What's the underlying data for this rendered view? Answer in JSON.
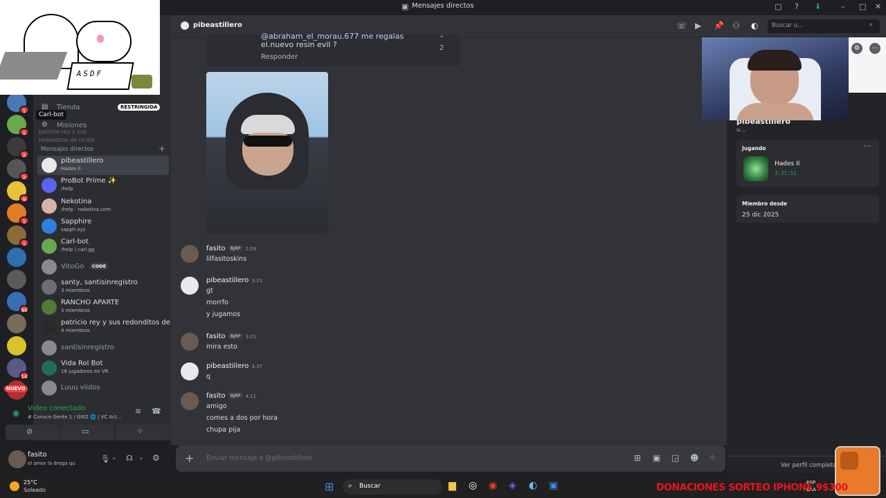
{
  "window": {
    "title": "Mensajes directos"
  },
  "overlay_keyboard_text": "ASDF",
  "sidebar": {
    "tienda": "Tienda",
    "restringida": "RESTRINGIDA",
    "tooltip": "Carl-bot",
    "tooltip_sub": "patricio rey y sus redonditos de ricota",
    "misiones": "Misiones",
    "dm_header": "Mensajes directos",
    "dms": [
      {
        "name": "pibeastillero",
        "sub": "Hades II",
        "color": "#e9e9e9"
      },
      {
        "name": "ProBot Prime ✨",
        "sub": "/help",
        "color": "#5865f2"
      },
      {
        "name": "Nekotina",
        "sub": "!help · nekotina.com",
        "color": "#d6b3a8"
      },
      {
        "name": "Sapphire",
        "sub": "sapph.xyz",
        "color": "#2f7fe0"
      },
      {
        "name": "Carl-bot",
        "sub": "/help | carl.gg",
        "color": "#6aa84f"
      },
      {
        "name": "VitoGo",
        "sub": "",
        "badge": "CODE",
        "color": "#8a8a8a"
      },
      {
        "name": "santy, santisinregistro",
        "sub": "3 miembros",
        "color": "#6d6f78"
      },
      {
        "name": "RANCHO APARTE",
        "sub": "3 miembros",
        "color": "#4f7a3a"
      },
      {
        "name": "patricio rey y sus redonditos de ...",
        "sub": "4 miembros",
        "color": "#2a2a2a"
      },
      {
        "name": "santisinregistro",
        "sub": "",
        "color": "#8a8a8a"
      },
      {
        "name": "Vida Rol Bot",
        "sub": "16 jugadores en VR.",
        "color": "#1f6d5a"
      },
      {
        "name": "Luuu viidos",
        "sub": "",
        "color": "#8a8a8a"
      }
    ],
    "servers": [
      {
        "badge": "1",
        "color": "#4a7ab5"
      },
      {
        "badge": "1",
        "color": "#6aa84f"
      },
      {
        "badge": "2",
        "color": "#3b3b3b"
      },
      {
        "badge": "2",
        "color": "#555555"
      },
      {
        "badge": "9",
        "color": "#e8c23a"
      },
      {
        "badge": "1",
        "color": "#e07b28"
      },
      {
        "badge": "1",
        "color": "#8b6b3a"
      },
      {
        "badge": "",
        "color": "#2f6fae"
      },
      {
        "badge": "",
        "color": "#5a5a5a"
      },
      {
        "badge": "90",
        "color": "#3a6fb5"
      },
      {
        "badge": "",
        "color": "#7a6a5a"
      },
      {
        "badge": "",
        "color": "#d9c22a"
      },
      {
        "badge": "14",
        "color": "#5a5a8a"
      },
      {
        "badge": "",
        "color": "#b03030"
      }
    ],
    "nuevo": "NUEVO",
    "voice": {
      "status": "Video conectado",
      "channel": "# Conoce Gente 1 / GW2 🌐 | VC Act..."
    },
    "user": {
      "name": "fasito",
      "status": "el amor la droga qu"
    }
  },
  "header": {
    "name": "pibeastillero",
    "search_placeholder": "Buscar u..."
  },
  "chat": {
    "reply_line1": "@abraham_el_morau.677 me regalas",
    "reply_line2": "el.nuevo resin  evil ?",
    "reply_count": "2",
    "reply_button": "Responder",
    "messages": [
      {
        "author": "fasito",
        "tag": "BJRP",
        "time": "2:59",
        "lines": [
          "lilfasitoskins"
        ],
        "avatar": "#6b5a50"
      },
      {
        "author": "pibeastillero",
        "tag": "",
        "time": "3:21",
        "lines": [
          "gt",
          "morrfo",
          "y jugamos"
        ],
        "avatar": "#e9e9e9"
      },
      {
        "author": "fasito",
        "tag": "BJRP",
        "time": "3:21",
        "lines": [
          "mira esto"
        ],
        "avatar": "#6b5a50"
      },
      {
        "author": "pibeastillero",
        "tag": "",
        "time": "3:37",
        "lines": [
          "q"
        ],
        "avatar": "#e9e9e9"
      },
      {
        "author": "fasito",
        "tag": "BJRP",
        "time": "4:11",
        "lines": [
          "amigo",
          "comes a dos por hora",
          "chupa pija"
        ],
        "avatar": "#6b5a50"
      }
    ],
    "composer_placeholder": "Enviar mensaje a @pibeastillero"
  },
  "profile": {
    "name": "pibeastillero",
    "sub": "u...",
    "playing_label": "Jugando",
    "game": "Hades II",
    "game_time": "3:31:51",
    "member_label": "Miembro desde",
    "member_date": "25 dic 2025",
    "view_full": "Ver perfil completo"
  },
  "taskbar": {
    "temp": "25°C",
    "weather": "Soleado",
    "search": "Buscar",
    "lang1": "ESP",
    "lang2": "LAA"
  },
  "donation_text": "DONACIONES SORTEO IPHONE 9$300"
}
